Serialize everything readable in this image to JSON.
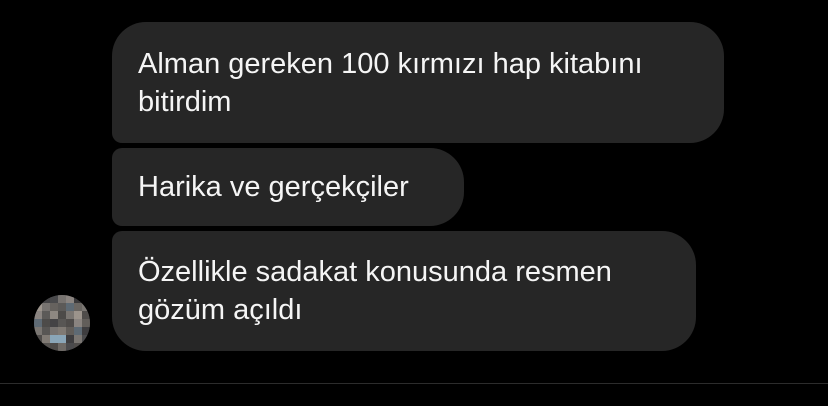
{
  "thread": {
    "messages": [
      {
        "text": "Alman gereken 100 kırmızı hap kitabını bitirdim"
      },
      {
        "text": "Harika ve gerçekçiler"
      },
      {
        "text": "Özellikle sadakat konusunda resmen gözüm açıldı"
      }
    ]
  },
  "colors": {
    "background": "#000000",
    "bubble": "#262626",
    "text": "#f5f5f5"
  },
  "avatar": {
    "icon": "pixelated-profile-photo"
  }
}
